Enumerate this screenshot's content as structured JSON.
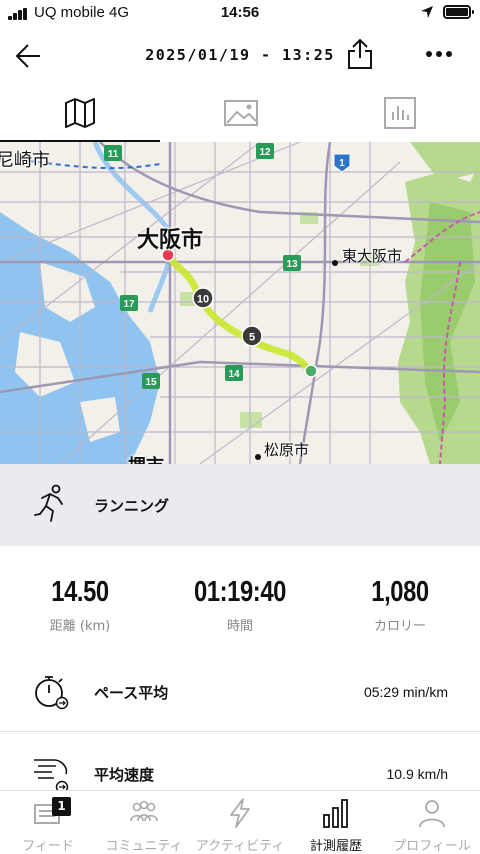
{
  "status_bar": {
    "carrier": "UQ mobile  4G",
    "time": "14:56"
  },
  "header": {
    "title": "2025/01/19 - 13:25"
  },
  "map": {
    "labels": {
      "amagasaki": "尼崎市",
      "osaka": "大阪市",
      "higashiosaka": "東大阪市",
      "matsubara": "松原市",
      "sakai": "堺市"
    },
    "markers": {
      "km10": "10",
      "km5": "5"
    },
    "route_shields": [
      "11",
      "12",
      "1",
      "13",
      "17",
      "14",
      "15"
    ]
  },
  "activity": {
    "type": "ランニング"
  },
  "stats": {
    "distance": {
      "value": "14.50",
      "label": "距離 (km)"
    },
    "duration": {
      "value": "01:19:40",
      "label": "時間"
    },
    "calories": {
      "value": "1,080",
      "label": "カロリー"
    }
  },
  "rows": {
    "pace": {
      "label": "ペース平均",
      "value": "05:29 min/km"
    },
    "speed": {
      "label": "平均速度",
      "value": "10.9 km/h"
    }
  },
  "nav": {
    "feed": "フィード",
    "community": "コミュニティ",
    "activity": "アクティビティ",
    "history": "計測履歴",
    "profile": "プロフィール",
    "badge": "1"
  }
}
